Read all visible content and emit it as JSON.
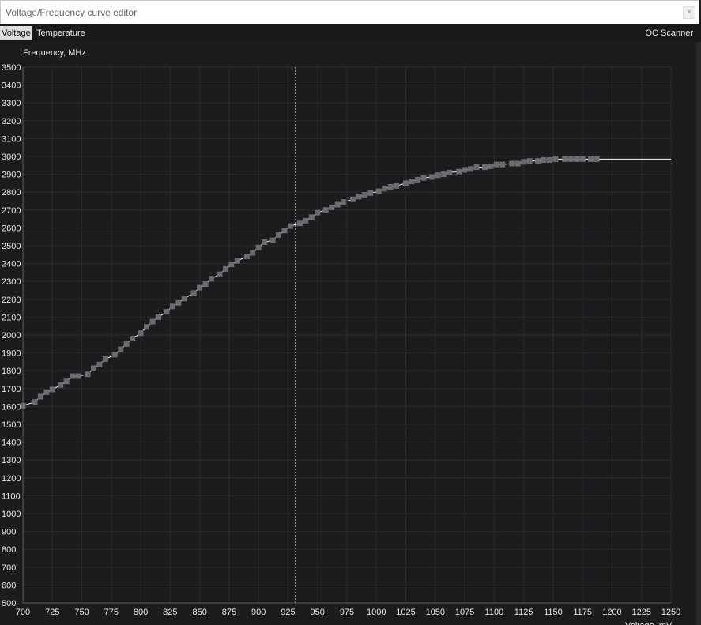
{
  "window": {
    "title": "Voltage/Frequency curve editor",
    "close_glyph": "×"
  },
  "tabs": [
    {
      "label": "Voltage",
      "active": true
    },
    {
      "label": "Temperature",
      "active": false
    }
  ],
  "oc_scanner_label": "OC Scanner",
  "colors": {
    "background": "#1c1c1f",
    "grid": "#2b2b2f",
    "curve": "#ffffff",
    "point": "#6c6c70",
    "cursor_line": "#888888"
  },
  "chart_data": {
    "type": "line",
    "ylabel": "Frequency, MHz",
    "xlabel": "Voltage, mV",
    "xlim": [
      700,
      1250
    ],
    "ylim": [
      500,
      3500
    ],
    "x_ticks": [
      700,
      725,
      750,
      775,
      800,
      825,
      850,
      875,
      900,
      925,
      950,
      975,
      1000,
      1025,
      1050,
      1075,
      1100,
      1125,
      1150,
      1175,
      1200,
      1225,
      1250
    ],
    "y_ticks": [
      500,
      600,
      700,
      800,
      900,
      1000,
      1100,
      1200,
      1300,
      1400,
      1500,
      1600,
      1700,
      1800,
      1900,
      2000,
      2100,
      2200,
      2300,
      2400,
      2500,
      2600,
      2700,
      2800,
      2900,
      3000,
      3100,
      3200,
      3300,
      3400,
      3500
    ],
    "grid": true,
    "selected_voltage": 931,
    "curve_end": [
      1250,
      2985
    ],
    "points": [
      [
        700,
        1605
      ],
      [
        710,
        1625
      ],
      [
        715,
        1655
      ],
      [
        720,
        1680
      ],
      [
        725,
        1695
      ],
      [
        732,
        1720
      ],
      [
        737,
        1740
      ],
      [
        742,
        1770
      ],
      [
        747,
        1770
      ],
      [
        755,
        1780
      ],
      [
        760,
        1815
      ],
      [
        765,
        1835
      ],
      [
        770,
        1865
      ],
      [
        778,
        1890
      ],
      [
        783,
        1920
      ],
      [
        788,
        1950
      ],
      [
        793,
        1980
      ],
      [
        800,
        2010
      ],
      [
        805,
        2045
      ],
      [
        810,
        2075
      ],
      [
        815,
        2100
      ],
      [
        822,
        2130
      ],
      [
        827,
        2160
      ],
      [
        832,
        2180
      ],
      [
        837,
        2205
      ],
      [
        845,
        2235
      ],
      [
        850,
        2265
      ],
      [
        855,
        2285
      ],
      [
        860,
        2315
      ],
      [
        867,
        2340
      ],
      [
        872,
        2370
      ],
      [
        877,
        2395
      ],
      [
        882,
        2415
      ],
      [
        890,
        2440
      ],
      [
        895,
        2460
      ],
      [
        900,
        2490
      ],
      [
        905,
        2520
      ],
      [
        912,
        2530
      ],
      [
        917,
        2560
      ],
      [
        922,
        2585
      ],
      [
        927,
        2610
      ],
      [
        935,
        2625
      ],
      [
        940,
        2640
      ],
      [
        945,
        2660
      ],
      [
        950,
        2685
      ],
      [
        957,
        2700
      ],
      [
        962,
        2715
      ],
      [
        967,
        2730
      ],
      [
        972,
        2745
      ],
      [
        980,
        2760
      ],
      [
        985,
        2775
      ],
      [
        990,
        2785
      ],
      [
        995,
        2795
      ],
      [
        1002,
        2805
      ],
      [
        1007,
        2820
      ],
      [
        1012,
        2830
      ],
      [
        1017,
        2835
      ],
      [
        1025,
        2850
      ],
      [
        1030,
        2860
      ],
      [
        1035,
        2870
      ],
      [
        1040,
        2880
      ],
      [
        1047,
        2885
      ],
      [
        1052,
        2895
      ],
      [
        1057,
        2900
      ],
      [
        1062,
        2910
      ],
      [
        1070,
        2915
      ],
      [
        1075,
        2925
      ],
      [
        1080,
        2930
      ],
      [
        1085,
        2940
      ],
      [
        1092,
        2940
      ],
      [
        1097,
        2945
      ],
      [
        1102,
        2955
      ],
      [
        1107,
        2955
      ],
      [
        1115,
        2960
      ],
      [
        1120,
        2960
      ],
      [
        1125,
        2970
      ],
      [
        1130,
        2975
      ],
      [
        1137,
        2975
      ],
      [
        1142,
        2980
      ],
      [
        1147,
        2980
      ],
      [
        1152,
        2985
      ],
      [
        1160,
        2985
      ],
      [
        1165,
        2985
      ],
      [
        1170,
        2985
      ],
      [
        1175,
        2985
      ],
      [
        1182,
        2985
      ],
      [
        1187,
        2985
      ]
    ]
  }
}
